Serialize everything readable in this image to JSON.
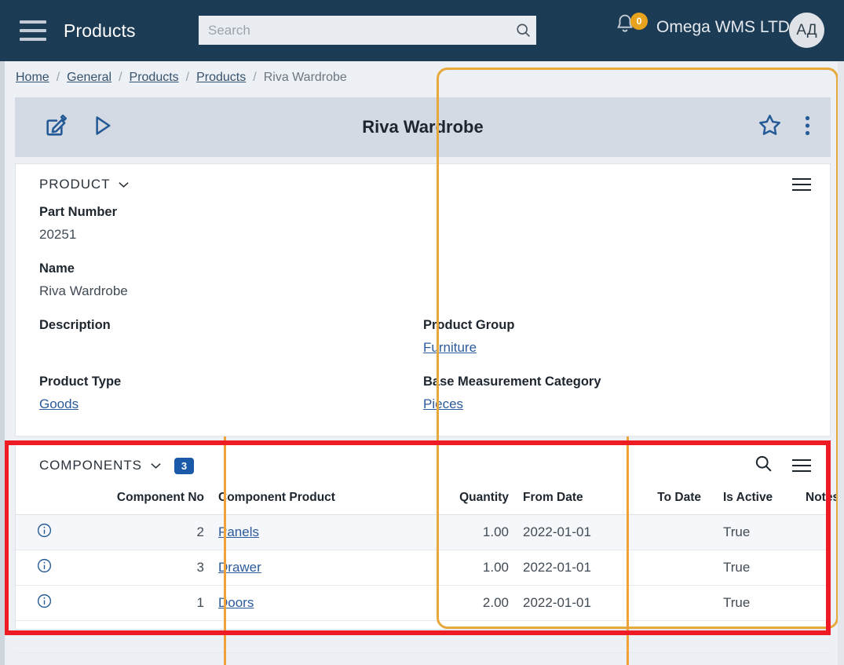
{
  "topbar": {
    "menu_icon": "hamburger-icon",
    "app_title": "Products",
    "search": {
      "value": "",
      "placeholder": "Search",
      "icon": "search-icon"
    },
    "notifications": {
      "icon": "bell-icon",
      "count": "0",
      "badge_color": "#e8a31e"
    },
    "company": "Omega WMS LTD",
    "avatar_initials": "АД",
    "bg_color": "#1c3b54"
  },
  "breadcrumb": {
    "items": [
      {
        "label": "Home",
        "link": true
      },
      {
        "label": "General",
        "link": true
      },
      {
        "label": "Products",
        "link": true
      },
      {
        "label": "Products",
        "link": true
      },
      {
        "label": "Riva Wardrobe",
        "link": false
      }
    ],
    "separator": "/"
  },
  "record_titlebar": {
    "title": "Riva Wardrobe",
    "left_icons": [
      "edit-icon",
      "run-icon"
    ],
    "right_icons": [
      "favorite-star-icon",
      "more-options-icon"
    ],
    "bg_color": "#d3dae4"
  },
  "product_section": {
    "title": "PRODUCT",
    "collapse_icon": "chevron-down-icon",
    "menu_icon": "hamburger-small-icon",
    "fields": [
      {
        "label": "Part Number",
        "value": "20251",
        "link": false
      },
      {
        "label": "Name",
        "value": "Riva Wardrobe",
        "link": false
      },
      {
        "label": "Description",
        "value": "",
        "link": false
      },
      {
        "label": "Product Type",
        "value": "Goods",
        "link": true
      },
      {
        "label": "Product Group",
        "value": "Furniture",
        "link": true
      },
      {
        "label": "Base Measurement Category",
        "value": "Pieces",
        "link": true
      }
    ]
  },
  "components_section": {
    "title": "COMPONENTS",
    "collapse_icon": "chevron-down-icon",
    "count": "3",
    "search_icon": "search-icon",
    "menu_icon": "hamburger-small-icon",
    "columns": [
      "",
      "Component No",
      "Component Product",
      "Quantity",
      "From Date",
      "To Date",
      "Is Active",
      "Notes"
    ],
    "rows": [
      {
        "info_icon": "info-icon",
        "component_no": "2",
        "component_product": "Panels",
        "quantity": "1.00",
        "from_date": "2022-01-01",
        "to_date": "",
        "is_active": "True",
        "notes": ""
      },
      {
        "info_icon": "info-icon",
        "component_no": "3",
        "component_product": "Drawer",
        "quantity": "1.00",
        "from_date": "2022-01-01",
        "to_date": "",
        "is_active": "True",
        "notes": ""
      },
      {
        "info_icon": "info-icon",
        "component_no": "1",
        "component_product": "Doors",
        "quantity": "2.00",
        "from_date": "2022-01-01",
        "to_date": "",
        "is_active": "True",
        "notes": ""
      }
    ]
  },
  "annotations": {
    "highlight_color": "#ee1b24",
    "pointer_color": "#e8a93c"
  }
}
